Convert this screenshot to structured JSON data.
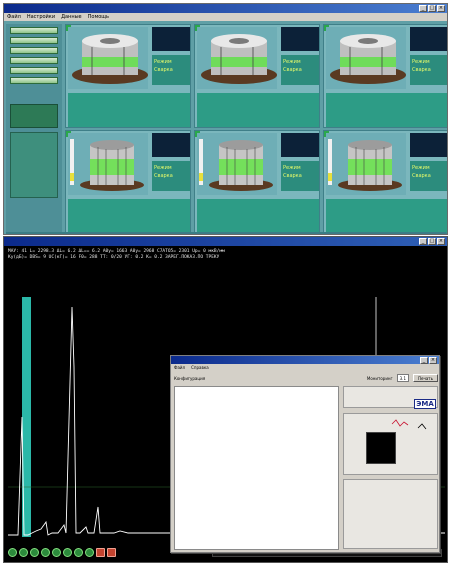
{
  "top_window": {
    "title": "",
    "menu": [
      "Файл",
      "Настройки",
      "Данные",
      "Помощь"
    ],
    "panels": [
      {
        "mode_line1": "Режим",
        "mode_line2": "Сварка"
      },
      {
        "mode_line1": "Режим",
        "mode_line2": "Сварка"
      },
      {
        "mode_line1": "Режим",
        "mode_line2": "Сварка"
      },
      {
        "mode_line1": "Режим",
        "mode_line2": "Сварка"
      },
      {
        "mode_line1": "Режим",
        "mode_line2": "Сварка"
      },
      {
        "mode_line1": "Режим",
        "mode_line2": "Сварка"
      }
    ]
  },
  "scope_window": {
    "title": "",
    "readout_line1": "МАУ: 41  L= 2298.3   ΔL=   6.2    ΔL==   6.2     A0у= 1663   A0у= 2968    C7ATO5= 2301   Uр= 0 мкВ/мм",
    "readout_line2": "Ку(дБ)=    DBS= 9   UC(кГ)= 16   F0= 288   TT: 0/20      УГ: 0.2      K= 0.2        ЗАРЕГ.ПОКАЗ.ПО ТРЕКУ"
  },
  "dialog": {
    "title": "",
    "menu": [
      "Файл",
      "Справка"
    ],
    "top_label_1": "Конфигурация",
    "top_label_2": "Мониторинг",
    "top_value": "3.1",
    "top_button": "Печать",
    "logo_text": "ЭМА"
  },
  "colors": {
    "panel_bg": "#7bb7bd",
    "stats_bg": "#2d9c86",
    "mode_text": "#e6fb6a",
    "trace": "#ffffff",
    "scope_bg": "#000000"
  }
}
